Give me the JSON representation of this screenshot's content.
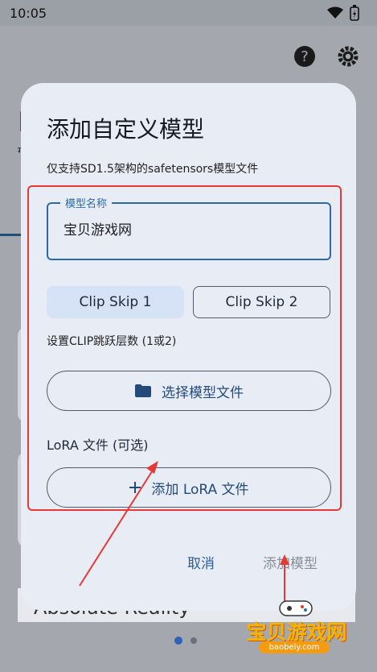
{
  "status_bar": {
    "time": "10:05"
  },
  "dialog": {
    "title": "添加自定义模型",
    "subtitle": "仅支持SD1.5架构的safetensors模型文件",
    "name_field": {
      "label": "模型名称",
      "value": "宝贝游戏网"
    },
    "clip_skip": {
      "option_1": "Clip Skip 1",
      "option_2": "Clip Skip 2",
      "selected": "Clip Skip 1"
    },
    "clip_hint": "设置CLIP跳跃层数 (1或2)",
    "select_model_button": "选择模型文件",
    "lora_label": "LoRA 文件 (可选)",
    "add_lora_button": "添加 LoRA 文件",
    "cancel": "取消",
    "confirm": "添加模型"
  },
  "background": {
    "title_fragment": "I",
    "subtitle_fragment": "ग",
    "bottom_card_title": "Absolute Reality"
  },
  "watermark": {
    "text": "宝贝游戏网",
    "url": "baobeiy.com"
  },
  "colors": {
    "primary": "#2d6aa6",
    "dialog_bg": "#e8edf5",
    "selected_segment": "#d6e3f7",
    "annotation": "#e53935",
    "watermark": "#f4b400"
  },
  "icons": [
    "wifi-icon",
    "battery-icon",
    "help-icon",
    "settings-icon",
    "folder-icon",
    "plus-icon"
  ]
}
